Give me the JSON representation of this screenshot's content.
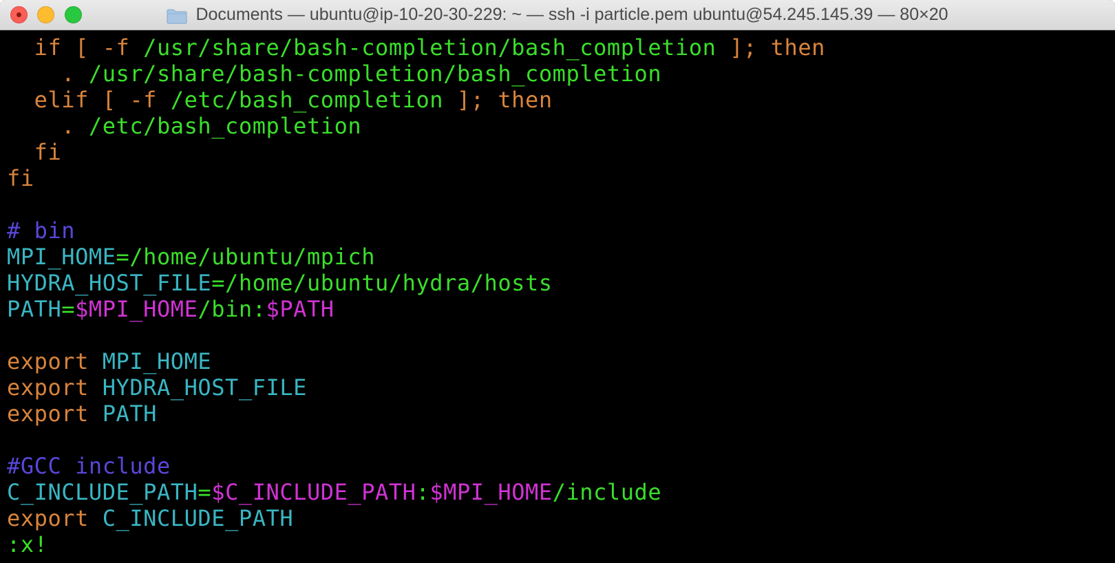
{
  "window": {
    "title": "Documents — ubuntu@ip-10-20-30-229: ~ — ssh -i particle.pem ubuntu@54.245.145.39 — 80×20",
    "icon": "folder-icon",
    "controls": [
      "close-button",
      "minimize-button",
      "zoom-button"
    ]
  },
  "colors": {
    "keyword": "#d9843c",
    "string_path": "#3bde2b",
    "variable": "#3ab6c3",
    "comment": "#5847d9",
    "expansion": "#d133d4",
    "background": "#000000"
  },
  "lines": [
    {
      "segments": [
        {
          "text": "  if [ -f ",
          "kind": "keyword"
        },
        {
          "text": "/usr/share/bash-completion/bash_completion",
          "kind": "string_path"
        },
        {
          "text": " ]; then",
          "kind": "keyword"
        }
      ]
    },
    {
      "segments": [
        {
          "text": "    . ",
          "kind": "keyword"
        },
        {
          "text": "/usr/share/bash-completion/bash_completion",
          "kind": "string_path"
        }
      ]
    },
    {
      "segments": [
        {
          "text": "  elif [ -f ",
          "kind": "keyword"
        },
        {
          "text": "/etc/bash_completion",
          "kind": "string_path"
        },
        {
          "text": " ]; then",
          "kind": "keyword"
        }
      ]
    },
    {
      "segments": [
        {
          "text": "    . ",
          "kind": "keyword"
        },
        {
          "text": "/etc/bash_completion",
          "kind": "string_path"
        }
      ]
    },
    {
      "segments": [
        {
          "text": "  fi",
          "kind": "keyword"
        }
      ]
    },
    {
      "segments": [
        {
          "text": "fi",
          "kind": "keyword"
        }
      ]
    },
    {
      "segments": []
    },
    {
      "segments": [
        {
          "text": "# bin",
          "kind": "comment"
        }
      ]
    },
    {
      "segments": [
        {
          "text": "MPI_HOME",
          "kind": "variable"
        },
        {
          "text": "=/home/ubuntu/mpich",
          "kind": "string_path"
        }
      ]
    },
    {
      "segments": [
        {
          "text": "HYDRA_HOST_FILE",
          "kind": "variable"
        },
        {
          "text": "=/home/ubuntu/hydra/hosts",
          "kind": "string_path"
        }
      ]
    },
    {
      "segments": [
        {
          "text": "PATH",
          "kind": "variable"
        },
        {
          "text": "=",
          "kind": "string_path"
        },
        {
          "text": "$MPI_HOME",
          "kind": "expansion"
        },
        {
          "text": "/bin:",
          "kind": "string_path"
        },
        {
          "text": "$PATH",
          "kind": "expansion"
        }
      ]
    },
    {
      "segments": []
    },
    {
      "segments": [
        {
          "text": "export ",
          "kind": "keyword"
        },
        {
          "text": "MPI_HOME",
          "kind": "variable"
        }
      ]
    },
    {
      "segments": [
        {
          "text": "export ",
          "kind": "keyword"
        },
        {
          "text": "HYDRA_HOST_FILE",
          "kind": "variable"
        }
      ]
    },
    {
      "segments": [
        {
          "text": "export ",
          "kind": "keyword"
        },
        {
          "text": "PATH",
          "kind": "variable"
        }
      ]
    },
    {
      "segments": []
    },
    {
      "segments": [
        {
          "text": "#GCC include",
          "kind": "comment"
        }
      ]
    },
    {
      "segments": [
        {
          "text": "C_INCLUDE_PATH",
          "kind": "variable"
        },
        {
          "text": "=",
          "kind": "string_path"
        },
        {
          "text": "$C_INCLUDE_PATH",
          "kind": "expansion"
        },
        {
          "text": ":",
          "kind": "string_path"
        },
        {
          "text": "$MPI_HOME",
          "kind": "expansion"
        },
        {
          "text": "/include",
          "kind": "string_path"
        }
      ]
    },
    {
      "segments": [
        {
          "text": "export ",
          "kind": "keyword"
        },
        {
          "text": "C_INCLUDE_PATH",
          "kind": "variable"
        }
      ]
    },
    {
      "segments": [
        {
          "text": ":x!",
          "kind": "string_path"
        }
      ]
    }
  ]
}
